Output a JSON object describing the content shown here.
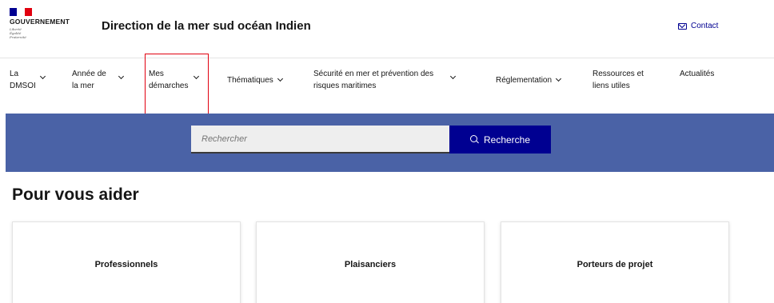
{
  "header": {
    "gov_name": "GOUVERNEMENT",
    "motto": [
      "Liberté",
      "Égalité",
      "Fraternité"
    ],
    "site_title": "Direction de la mer sud océan Indien",
    "contact_label": "Contact",
    "contact_icon": "envelope-icon"
  },
  "nav": {
    "items": [
      {
        "label": "La\nDMSOI",
        "has_dropdown": true
      },
      {
        "label": "Année de\nla mer",
        "has_dropdown": true
      },
      {
        "label": "Mes\ndémarches",
        "has_dropdown": true,
        "highlighted": true
      },
      {
        "label": "Thématiques",
        "has_dropdown": true
      },
      {
        "label": "Sécurité en mer et prévention des\nrisques maritimes",
        "has_dropdown": true
      },
      {
        "label": "Réglementation",
        "has_dropdown": true
      },
      {
        "label": "Ressources et\nliens utiles",
        "has_dropdown": false
      },
      {
        "label": "Actualités",
        "has_dropdown": false
      }
    ]
  },
  "search": {
    "placeholder": "Rechercher",
    "button_label": "Recherche",
    "button_icon": "search-icon"
  },
  "section": {
    "title": "Pour vous aider",
    "cards": [
      "Professionnels",
      "Plaisanciers",
      "Porteurs de projet"
    ]
  },
  "colors": {
    "brand_blue": "#000091",
    "band_blue": "#4a62a6",
    "highlight_red": "#e1000f",
    "input_grey": "#eeeeee"
  }
}
